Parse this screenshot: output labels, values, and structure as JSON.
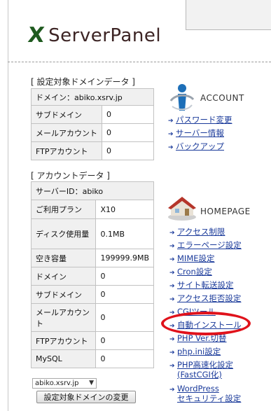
{
  "app": {
    "logo_mark": "X",
    "logo_text": "ServerPanel"
  },
  "domain_data": {
    "title": "[ 設定対象ドメインデータ ]",
    "domain_line": "ドメイン：abiko.xsrv.jp",
    "rows": [
      {
        "label": "サブドメイン",
        "value": "0"
      },
      {
        "label": "メールアカウント",
        "value": "0"
      },
      {
        "label": "FTPアカウント",
        "value": "0"
      }
    ]
  },
  "account_data": {
    "title": "[ アカウントデータ ]",
    "server_id_line": "サーバーID：abiko",
    "rows": [
      {
        "label": "ご利用プラン",
        "value": "X10"
      },
      {
        "label": "ディスク使用量",
        "value": "0.1MB"
      },
      {
        "label": "空き容量",
        "value": "199999.9MB"
      },
      {
        "label": "ドメイン",
        "value": "0"
      },
      {
        "label": "サブドメイン",
        "value": "0"
      },
      {
        "label": "メールアカウント",
        "value": "0"
      },
      {
        "label": "FTPアカウント",
        "value": "0"
      },
      {
        "label": "MySQL",
        "value": "0"
      }
    ]
  },
  "domain_select": {
    "selected": "abiko.xsrv.jp",
    "button_label": "設定対象ドメインの変更"
  },
  "account_menu": {
    "heading": "ACCOUNT",
    "icon": "account-person-icon",
    "links": [
      "パスワード変更",
      "サーバー情報",
      "バックアップ"
    ]
  },
  "homepage_menu": {
    "heading": "HOMEPAGE",
    "icon": "house-icon",
    "links": [
      "アクセス制限",
      "エラーページ設定",
      "MIME設定",
      "Cron設定",
      "サイト転送設定",
      "アクセス拒否設定",
      "CGIツール",
      "自動インストール",
      "PHP Ver.切替",
      "php.ini設定",
      "PHP高速化設定",
      "(FastCGI化)",
      "WordPress",
      "セキュリティ設定"
    ]
  },
  "highlight": {
    "color": "#e0121b",
    "target": "自動インストール"
  }
}
